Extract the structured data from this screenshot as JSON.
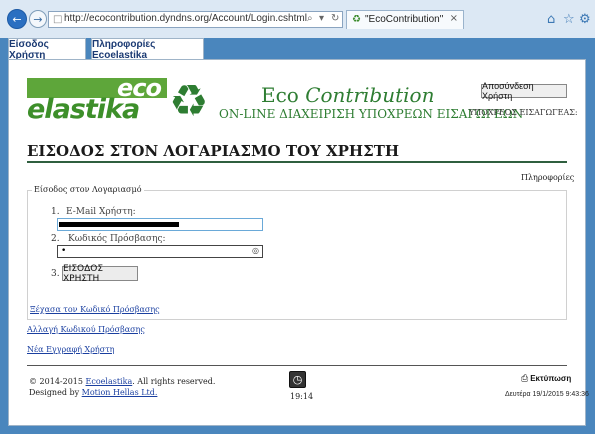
{
  "browser": {
    "url": "http://ecocontribution.dyndns.org/Account/Login.cshtml",
    "tab_title": "\"EcoContribution\"",
    "icons": {
      "back": "back-arrow-icon",
      "forward": "forward-arrow-icon",
      "home": "home-icon",
      "favorites": "star-icon",
      "settings": "gear-icon"
    }
  },
  "site_tabs": [
    {
      "label": "Είσοδος Χρήστη"
    },
    {
      "label": "Πληροφορίες Ecoelastika"
    }
  ],
  "logo": {
    "eco": "eco",
    "elastika": "elastika"
  },
  "header": {
    "brand_prefix": "Eco",
    "brand_suffix": "Contribution",
    "subtitle": "ON-LINE ΔΙΑΧΕΙΡΙΣΗ ΥΠΟΧΡΕΩΝ ΕΙΣΑΓΩΓΕΩΝ",
    "logout_label": "Αποσύνδεση Χρήστη",
    "obligated_label": "ΥΠΟΧΡΕΟΣ ΕΙΣΑΓΩΓΕΑΣ:"
  },
  "main": {
    "title": "ΕΙΣΟΔΟΣ ΣΤΟΝ ΛΟΓΑΡΙΑΣΜΟ ΤΟΥ ΧΡΗΣΤΗ",
    "info_link": "Πληροφορίες",
    "fieldset_legend": "Είσοδος στον Λογαριασμό",
    "fields": {
      "email_num": "1.",
      "email_label": "E-Mail Χρήστη:",
      "password_num": "2.",
      "password_label": "Κωδικός Πρόσβασης:",
      "password_value": "•",
      "submit_num": "3."
    },
    "login_button": "ΕΙΣΟΔΟΣ ΧΡΗΣΤΗ",
    "forgot_link": "Ξέχασα τον Κωδικό Πρόσβασης",
    "change_password_link": "Αλλαγή Κωδικού Πρόσβασης",
    "register_link": "Νέα Εγγραφή Χρήστη"
  },
  "footer": {
    "copyright_prefix": "© 2014-2015",
    "copyright_company": "Ecoelastika",
    "copyright_suffix": ". All rights reserved.",
    "designed_prefix": "Designed by",
    "designed_company": "Motion Hellas Ltd.",
    "clock_time": "19:14",
    "print_label": "Εκτύπωση",
    "datetime": "Δευτέρα 19/1/2015 9:43:36"
  }
}
